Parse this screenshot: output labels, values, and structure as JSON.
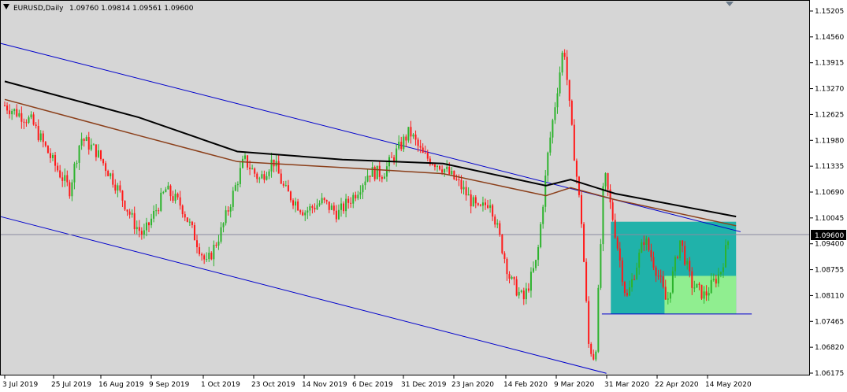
{
  "header": {
    "symbol": "EURUSD,Daily",
    "ohlc": "1.09760 1.09814 1.09561 1.09600"
  },
  "price_tag": "1.09600",
  "colors": {
    "background": "#d6d6d6",
    "frame": "#000000",
    "bull_candle": "#2db32d",
    "bear_candle": "#ff1a1a",
    "ma_fast": "#8b3f1a",
    "ma_slow": "#000000",
    "channel": "#0000cc",
    "zone_outer": "#20b2aa",
    "zone_inner": "#90ee90",
    "price_line": "#8a8aa0"
  },
  "chart_data": {
    "type": "candlestick",
    "symbol": "EURUSD",
    "timeframe": "Daily",
    "title": "EURUSD,Daily",
    "last_ohlc": {
      "open": 1.0976,
      "high": 1.09814,
      "low": 1.09561,
      "close": 1.096
    },
    "y_ticks": [
      "1.15205",
      "1.14560",
      "1.13915",
      "1.13270",
      "1.12625",
      "1.11980",
      "1.11335",
      "1.10690",
      "1.10045",
      "1.09400",
      "1.08755",
      "1.08110",
      "1.07465",
      "1.06820",
      "1.06175"
    ],
    "x_ticks": [
      "3 Jul 2019",
      "25 Jul 2019",
      "16 Aug 2019",
      "9 Sep 2019",
      "1 Oct 2019",
      "23 Oct 2019",
      "14 Nov 2019",
      "6 Dec 2019",
      "31 Dec 2019",
      "23 Jan 2020",
      "14 Feb 2020",
      "9 Mar 2020",
      "31 Mar 2020",
      "22 Apr 2020",
      "14 May 2020"
    ],
    "ylim": [
      1.0612,
      1.1527
    ],
    "current_price": 1.096,
    "close_path": [
      [
        "2019-07-03",
        1.1285
      ],
      [
        "2019-07-15",
        1.1245
      ],
      [
        "2019-07-25",
        1.114
      ],
      [
        "2019-08-01",
        1.1075
      ],
      [
        "2019-08-06",
        1.1205
      ],
      [
        "2019-08-13",
        1.117
      ],
      [
        "2019-08-21",
        1.1095
      ],
      [
        "2019-08-30",
        1.099
      ],
      [
        "2019-09-03",
        1.096
      ],
      [
        "2019-09-13",
        1.1075
      ],
      [
        "2019-09-20",
        1.1035
      ],
      [
        "2019-09-30",
        1.0905
      ],
      [
        "2019-10-01",
        1.0885
      ],
      [
        "2019-10-08",
        1.0975
      ],
      [
        "2019-10-18",
        1.115
      ],
      [
        "2019-10-25",
        1.11
      ],
      [
        "2019-10-31",
        1.115
      ],
      [
        "2019-11-05",
        1.1075
      ],
      [
        "2019-11-14",
        1.102
      ],
      [
        "2019-11-22",
        1.1045
      ],
      [
        "2019-11-29",
        1.1015
      ],
      [
        "2019-12-06",
        1.106
      ],
      [
        "2019-12-13",
        1.112
      ],
      [
        "2019-12-19",
        1.1115
      ],
      [
        "2019-12-31",
        1.122
      ],
      [
        "2020-01-06",
        1.116
      ],
      [
        "2020-01-14",
        1.1135
      ],
      [
        "2020-01-22",
        1.109
      ],
      [
        "2020-01-31",
        1.102
      ],
      [
        "2020-02-05",
        1.105
      ],
      [
        "2020-02-14",
        1.085
      ],
      [
        "2020-02-20",
        1.08
      ],
      [
        "2020-02-26",
        1.09
      ],
      [
        "2020-03-02",
        1.117
      ],
      [
        "2020-03-09",
        1.144
      ],
      [
        "2020-03-12",
        1.125
      ],
      [
        "2020-03-17",
        1.099
      ],
      [
        "2020-03-20",
        1.069
      ],
      [
        "2020-03-23",
        1.065
      ],
      [
        "2020-03-27",
        1.112
      ],
      [
        "2020-03-31",
        1.1
      ],
      [
        "2020-04-06",
        1.08
      ],
      [
        "2020-04-14",
        1.0955
      ],
      [
        "2020-04-21",
        1.085
      ],
      [
        "2020-04-24",
        1.079
      ],
      [
        "2020-04-30",
        1.095
      ],
      [
        "2020-05-05",
        1.084
      ],
      [
        "2020-05-11",
        1.081
      ],
      [
        "2020-05-18",
        1.087
      ],
      [
        "2020-05-22",
        1.096
      ]
    ],
    "series": [
      {
        "name": "",
        "type": "moving_average",
        "color": "#000000",
        "values": [
          [
            "2019-07-03",
            1.1345
          ],
          [
            "2019-09-01",
            1.1255
          ],
          [
            "2019-10-15",
            1.117
          ],
          [
            "2019-12-01",
            1.115
          ],
          [
            "2020-01-15",
            1.114
          ],
          [
            "2020-03-01",
            1.1085
          ],
          [
            "2020-03-12",
            1.11
          ],
          [
            "2020-04-01",
            1.1065
          ],
          [
            "2020-05-25",
            1.1008
          ]
        ]
      },
      {
        "name": "",
        "type": "moving_average",
        "color": "#8b3f1a",
        "values": [
          [
            "2019-07-03",
            1.13
          ],
          [
            "2019-09-01",
            1.121
          ],
          [
            "2019-10-15",
            1.1145
          ],
          [
            "2019-12-01",
            1.113
          ],
          [
            "2020-01-15",
            1.1115
          ],
          [
            "2020-03-01",
            1.106
          ],
          [
            "2020-03-12",
            1.108
          ],
          [
            "2020-04-01",
            1.105
          ],
          [
            "2020-05-25",
            1.0985
          ]
        ]
      }
    ],
    "trendlines": [
      {
        "color": "#0000cc",
        "points": [
          [
            "2019-07-01",
            1.144
          ],
          [
            "2020-05-27",
            1.097
          ]
        ]
      },
      {
        "color": "#0000cc",
        "points": [
          [
            "2019-07-01",
            1.1008
          ],
          [
            "2020-03-28",
            1.0617
          ]
        ]
      },
      {
        "color": "#0000cc",
        "points": [
          [
            "2020-03-26",
            1.0765
          ],
          [
            "2020-06-01",
            1.0765
          ]
        ]
      }
    ],
    "zones": [
      {
        "color": "#20b2aa",
        "x0": "2020-03-30",
        "x1": "2020-05-25",
        "y_top": 1.0995,
        "y_bottom": 1.0765
      },
      {
        "color": "#90ee90",
        "x0": "2020-04-23",
        "x1": "2020-05-25",
        "y_top": 1.086,
        "y_bottom": 1.0765
      }
    ],
    "grid": false
  }
}
